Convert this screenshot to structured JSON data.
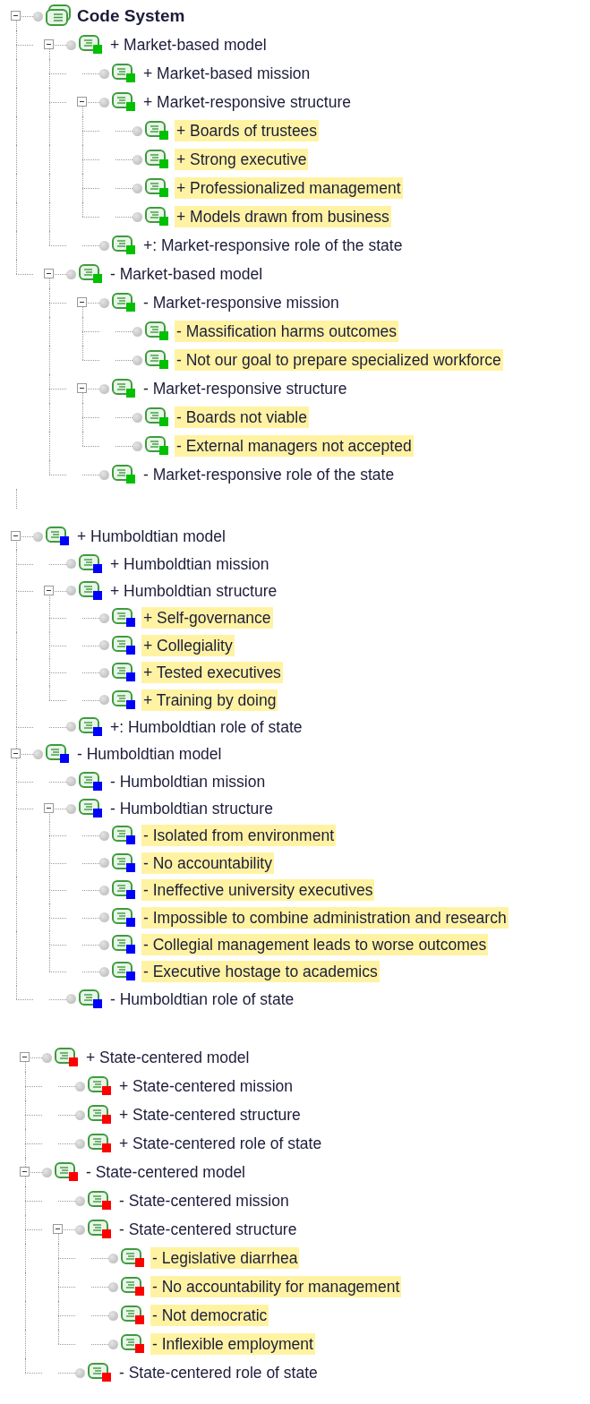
{
  "sections": [
    {
      "nodes": [
        {
          "kind": "root",
          "label": "Code System",
          "expanded": true,
          "children": [
            {
              "kind": "code",
              "label": "+ Market-based model",
              "color": "#00c000",
              "highlighted": false,
              "expanded": true,
              "children": [
                {
                  "kind": "code",
                  "label": "+ Market-based mission",
                  "color": "#00c000",
                  "highlighted": false
                },
                {
                  "kind": "code",
                  "label": "+ Market-responsive structure",
                  "color": "#00c000",
                  "highlighted": false,
                  "expanded": true,
                  "children": [
                    {
                      "kind": "code",
                      "label": "+ Boards of trustees",
                      "color": "#00c000",
                      "highlighted": true
                    },
                    {
                      "kind": "code",
                      "label": "+ Strong executive",
                      "color": "#00c000",
                      "highlighted": true
                    },
                    {
                      "kind": "code",
                      "label": "+ Professionalized management",
                      "color": "#00c000",
                      "highlighted": true
                    },
                    {
                      "kind": "code",
                      "label": "+ Models drawn from business",
                      "color": "#00c000",
                      "highlighted": true
                    }
                  ]
                },
                {
                  "kind": "code",
                  "label": "+: Market-responsive role of the state",
                  "color": "#00c000",
                  "highlighted": false
                }
              ]
            },
            {
              "kind": "code",
              "label": "- Market-based model",
              "color": "#00c000",
              "highlighted": false,
              "expanded": true,
              "children": [
                {
                  "kind": "code",
                  "label": "- Market-responsive mission",
                  "color": "#00c000",
                  "highlighted": false,
                  "expanded": true,
                  "children": [
                    {
                      "kind": "code",
                      "label": "- Massification harms outcomes",
                      "color": "#00c000",
                      "highlighted": true
                    },
                    {
                      "kind": "code",
                      "label": "- Not our goal to prepare specialized workforce",
                      "color": "#00c000",
                      "highlighted": true
                    }
                  ]
                },
                {
                  "kind": "code",
                  "label": "- Market-responsive structure",
                  "color": "#00c000",
                  "highlighted": false,
                  "expanded": true,
                  "children": [
                    {
                      "kind": "code",
                      "label": "- Boards not viable",
                      "color": "#00c000",
                      "highlighted": true
                    },
                    {
                      "kind": "code",
                      "label": "- External managers not accepted",
                      "color": "#00c000",
                      "highlighted": true
                    }
                  ]
                },
                {
                  "kind": "code",
                  "label": "- Market-responsive role of the state",
                  "color": "#00c000",
                  "highlighted": false
                }
              ]
            }
          ]
        }
      ]
    },
    {
      "nodes": [
        {
          "kind": "code",
          "label": "+ Humboldtian model",
          "color": "#0000ff",
          "highlighted": false,
          "expanded": true,
          "children": [
            {
              "kind": "code",
              "label": "+ Humboldtian mission",
              "color": "#0000ff",
              "highlighted": false
            },
            {
              "kind": "code",
              "label": "+ Humboldtian structure",
              "color": "#0000ff",
              "highlighted": false,
              "expanded": true,
              "children": [
                {
                  "kind": "code",
                  "label": "+ Self-governance",
                  "color": "#0000ff",
                  "highlighted": true
                },
                {
                  "kind": "code",
                  "label": "+ Collegiality",
                  "color": "#0000ff",
                  "highlighted": true
                },
                {
                  "kind": "code",
                  "label": "+ Tested executives",
                  "color": "#0000ff",
                  "highlighted": true
                },
                {
                  "kind": "code",
                  "label": "+ Training by doing",
                  "color": "#0000ff",
                  "highlighted": true
                }
              ]
            },
            {
              "kind": "code",
              "label": "+: Humboldtian role of state",
              "color": "#0000ff",
              "highlighted": false
            }
          ]
        },
        {
          "kind": "code",
          "label": "- Humboldtian model",
          "color": "#0000ff",
          "highlighted": false,
          "expanded": true,
          "children": [
            {
              "kind": "code",
              "label": "- Humboldtian mission",
              "color": "#0000ff",
              "highlighted": false
            },
            {
              "kind": "code",
              "label": "- Humboldtian structure",
              "color": "#0000ff",
              "highlighted": false,
              "expanded": true,
              "children": [
                {
                  "kind": "code",
                  "label": "- Isolated from environment",
                  "color": "#0000ff",
                  "highlighted": true
                },
                {
                  "kind": "code",
                  "label": "- No accountability",
                  "color": "#0000ff",
                  "highlighted": true
                },
                {
                  "kind": "code",
                  "label": "- Ineffective university executives",
                  "color": "#0000ff",
                  "highlighted": true
                },
                {
                  "kind": "code",
                  "label": "- Impossible to combine administration and research",
                  "color": "#0000ff",
                  "highlighted": true
                },
                {
                  "kind": "code",
                  "label": "- Collegial management leads to worse outcomes",
                  "color": "#0000ff",
                  "highlighted": true
                },
                {
                  "kind": "code",
                  "label": "- Executive hostage to academics",
                  "color": "#0000ff",
                  "highlighted": true
                }
              ]
            },
            {
              "kind": "code",
              "label": "- Humboldtian role of state",
              "color": "#0000ff",
              "highlighted": false
            }
          ]
        }
      ]
    },
    {
      "nodes": [
        {
          "kind": "code",
          "label": "+ State-centered model",
          "color": "#ff0000",
          "highlighted": false,
          "expanded": true,
          "children": [
            {
              "kind": "code",
              "label": "+ State-centered mission",
              "color": "#ff0000",
              "highlighted": false
            },
            {
              "kind": "code",
              "label": "+ State-centered structure",
              "color": "#ff0000",
              "highlighted": false
            },
            {
              "kind": "code",
              "label": "+ State-centered role of state",
              "color": "#ff0000",
              "highlighted": false
            }
          ]
        },
        {
          "kind": "code",
          "label": "- State-centered model",
          "color": "#ff0000",
          "highlighted": false,
          "expanded": true,
          "children": [
            {
              "kind": "code",
              "label": "- State-centered mission",
              "color": "#ff0000",
              "highlighted": false
            },
            {
              "kind": "code",
              "label": "- State-centered structure",
              "color": "#ff0000",
              "highlighted": false,
              "expanded": true,
              "children": [
                {
                  "kind": "code",
                  "label": "- Legislative diarrhea",
                  "color": "#ff0000",
                  "highlighted": true
                },
                {
                  "kind": "code",
                  "label": "- No accountability for management",
                  "color": "#ff0000",
                  "highlighted": true
                },
                {
                  "kind": "code",
                  "label": "- Not democratic",
                  "color": "#ff0000",
                  "highlighted": true
                },
                {
                  "kind": "code",
                  "label": "- Inflexible employment",
                  "color": "#ff0000",
                  "highlighted": true
                }
              ]
            },
            {
              "kind": "code",
              "label": "- State-centered role of state",
              "color": "#ff0000",
              "highlighted": false
            }
          ]
        }
      ]
    }
  ]
}
